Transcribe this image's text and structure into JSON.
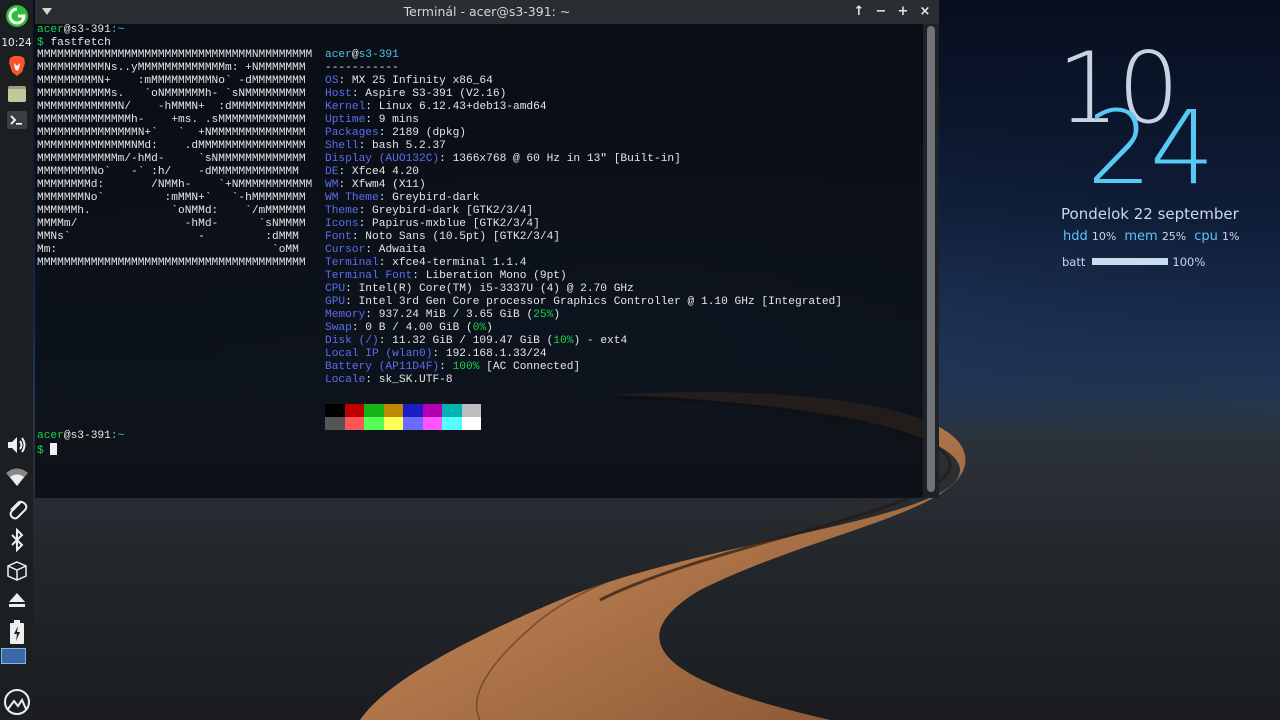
{
  "panel": {
    "time": "10:24",
    "icons": [
      "mx-menu-icon",
      "brave-browser-icon",
      "file-manager-icon",
      "terminal-icon",
      "volume-icon",
      "wifi-icon",
      "clip-icon",
      "bluetooth-icon",
      "package-icon",
      "eject-icon",
      "battery-icon",
      "workspace-icon",
      "mx-logo-icon"
    ]
  },
  "window": {
    "title": "Terminál - acer@s3-391: ~",
    "buttons": [
      "↑",
      "−",
      "+",
      "×"
    ]
  },
  "terminal": {
    "prompt_user": "acer",
    "prompt_host": "@s3-391",
    "prompt_path": ":~",
    "prompt_symbol": "$",
    "command": "fastfetch",
    "logo": [
      "MMMMMMMMMMMMMMMMMMMMMMMMMMMMMMMMNMMMMMMMM",
      "MMMMMMMMMMNs..yMMMMMMMMMMMMMm: +NMMMMMMM",
      "MMMMMMMMMN+    :mMMMMMMMMMNo` -dMMMMMMMM",
      "MMMMMMMMMMMs.   `oNMMMMMMh- `sNMMMMMMMMM",
      "MMMMMMMMMMMMN/    -hMMMN+  :dMMMMMMMMMMM",
      "MMMMMMMMMMMMMMh-    +ms. .sMMMMMMMMMMMMM",
      "MMMMMMMMMMMMMMMN+`   `  +NMMMMMMMMMMMMMM",
      "MMMMMMMMMMMMMMNMd:    .dMMMMMMMMMMMMMMMM",
      "MMMMMMMMMMMMm/-hMd-     `sNMMMMMMMMMMMMM",
      "MMMMMMMMNo`   -` :h/    -dMMMMMMMMMMMMM",
      "MMMMMMMMd:       /NMMh-    `+NMMMMMMMMMMM",
      "MMMMMMMNo`         :mMMN+`   `-hMMMMMMMM",
      "MMMMMMh.            `oNMMd:    `/mMMMMMM",
      "MMMMm/                -hMd-      `sNMMMM",
      "MMNs`                   -         :dMMM",
      "Mm:                                `oMM",
      "MMMMMMMMMMMMMMMMMMMMMMMMMMMMMMMMMMMMMMMM"
    ],
    "info_title_user": "acer",
    "info_title_host": "s3-391",
    "separator": "-----------",
    "info": [
      {
        "key": "OS",
        "value": "MX 25 Infinity x86_64"
      },
      {
        "key": "Host",
        "value": "Aspire S3-391 (V2.16)"
      },
      {
        "key": "Kernel",
        "value": "Linux 6.12.43+deb13-amd64"
      },
      {
        "key": "Uptime",
        "value": "9 mins"
      },
      {
        "key": "Packages",
        "value": "2189 (dpkg)"
      },
      {
        "key": "Shell",
        "value": "bash 5.2.37"
      },
      {
        "key": "Display (AUO132C)",
        "value": "1366x768 @ 60 Hz in 13\" [Built-in]"
      },
      {
        "key": "DE",
        "value": "Xfce4 4.20"
      },
      {
        "key": "WM",
        "value": "Xfwm4 (X11)"
      },
      {
        "key": "WM Theme",
        "value": "Greybird-dark"
      },
      {
        "key": "Theme",
        "value": "Greybird-dark [GTK2/3/4]"
      },
      {
        "key": "Icons",
        "value": "Papirus-mxblue [GTK2/3/4]"
      },
      {
        "key": "Font",
        "value": "Noto Sans (10.5pt) [GTK2/3/4]"
      },
      {
        "key": "Cursor",
        "value": "Adwaita"
      },
      {
        "key": "Terminal",
        "value": "xfce4-terminal 1.1.4"
      },
      {
        "key": "Terminal Font",
        "value": "Liberation Mono (9pt)"
      },
      {
        "key": "CPU",
        "value": "Intel(R) Core(TM) i5-3337U (4) @ 2.70 GHz"
      },
      {
        "key": "GPU",
        "value": "Intel 3rd Gen Core processor Graphics Controller @ 1.10 GHz [Integrated]"
      },
      {
        "key": "Memory",
        "value": "937.24 MiB / 3.65 GiB ",
        "pct": "25%",
        "post": ""
      },
      {
        "key": "Swap",
        "value": "0 B / 4.00 GiB ",
        "pct": "0%",
        "post": ""
      },
      {
        "key": "Disk (/)",
        "value": "11.32 GiB / 109.47 GiB ",
        "pct": "10%",
        "post": " - ext4"
      },
      {
        "key": "Local IP (wlan0)",
        "value": "192.168.1.33/24"
      },
      {
        "key": "Battery (AP11D4F)",
        "value": "",
        "pct": "100%",
        "post": " [AC Connected]"
      },
      {
        "key": "Locale",
        "value": "sk_SK.UTF-8"
      }
    ],
    "palette_dark": [
      "#000000",
      "#c00000",
      "#15b315",
      "#c08a00",
      "#1d1dc8",
      "#b200b2",
      "#00b4b4",
      "#bdbdbd"
    ],
    "palette_bright": [
      "#555555",
      "#ff5555",
      "#55ff55",
      "#ffff55",
      "#6b6bff",
      "#ff55ff",
      "#55ffff",
      "#ffffff"
    ]
  },
  "conky": {
    "hour": "10",
    "minute": "24",
    "date": "Pondelok  22 september",
    "stats": [
      {
        "label": "hdd",
        "value": "10%"
      },
      {
        "label": "mem",
        "value": "25%"
      },
      {
        "label": "cpu",
        "value": "1%"
      }
    ],
    "batt_label": "batt",
    "batt_value": "100%",
    "batt_level": 1.0
  }
}
